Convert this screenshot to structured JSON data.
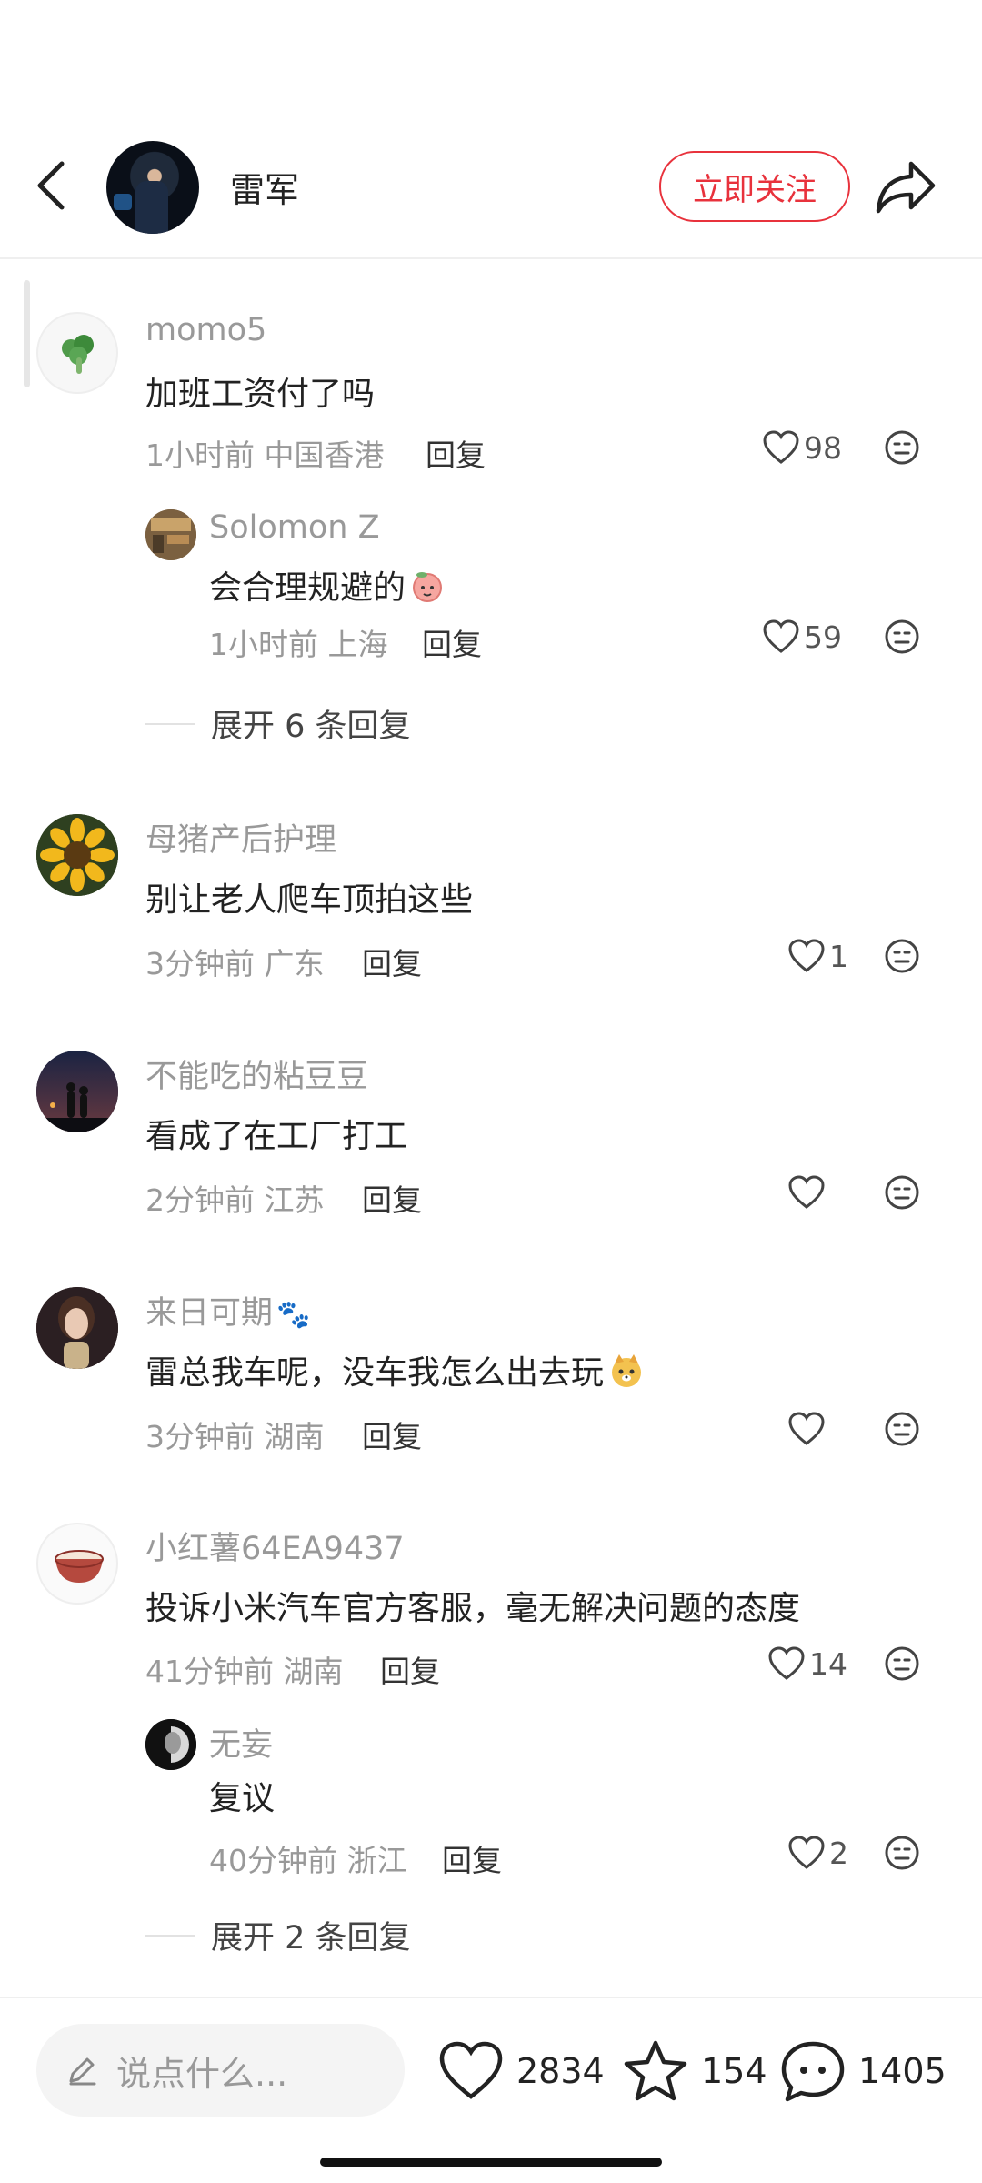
{
  "header": {
    "author_name": "雷军",
    "follow_label": "立即关注"
  },
  "comments": [
    {
      "name": "momo5",
      "text": "加班工资付了吗",
      "time": "1小时前 中国香港",
      "reply_label": "回复",
      "likes": "98",
      "sub": {
        "name": "Solomon Z",
        "text": "会合理规避的",
        "time": "1小时前 上海",
        "reply_label": "回复",
        "likes": "59"
      },
      "expand_label": "展开 6 条回复"
    },
    {
      "name": "母猪产后护理",
      "text": "别让老人爬车顶拍这些",
      "time": "3分钟前 广东",
      "reply_label": "回复",
      "likes": "1"
    },
    {
      "name": "不能吃的粘豆豆",
      "text": "看成了在工厂打工",
      "time": "2分钟前 江苏",
      "reply_label": "回复",
      "likes": ""
    },
    {
      "name": "来日可期",
      "name_emoji": "🐾",
      "text": "雷总我车呢，没车我怎么出去玩",
      "time": "3分钟前 湖南",
      "reply_label": "回复",
      "likes": ""
    },
    {
      "name": "小红薯64EA9437",
      "text": "投诉小米汽车官方客服，毫无解决问题的态度",
      "time": "41分钟前 湖南",
      "reply_label": "回复",
      "likes": "14",
      "sub": {
        "name": "无妄",
        "text": "复议",
        "time": "40分钟前 浙江",
        "reply_label": "回复",
        "likes": "2"
      },
      "expand_label": "展开 2 条回复"
    }
  ],
  "bottom": {
    "input_placeholder": "说点什么...",
    "likes": "2834",
    "collects": "154",
    "comments": "1405"
  },
  "colors": {
    "accent": "#e8323c",
    "muted_text": "#999999"
  },
  "icons": [
    "back-arrow-icon",
    "share-icon",
    "heart-icon",
    "dislike-face-icon",
    "pencil-icon",
    "star-icon",
    "comment-bubble-icon",
    "peach-emoji-icon",
    "fox-emoji-icon"
  ]
}
